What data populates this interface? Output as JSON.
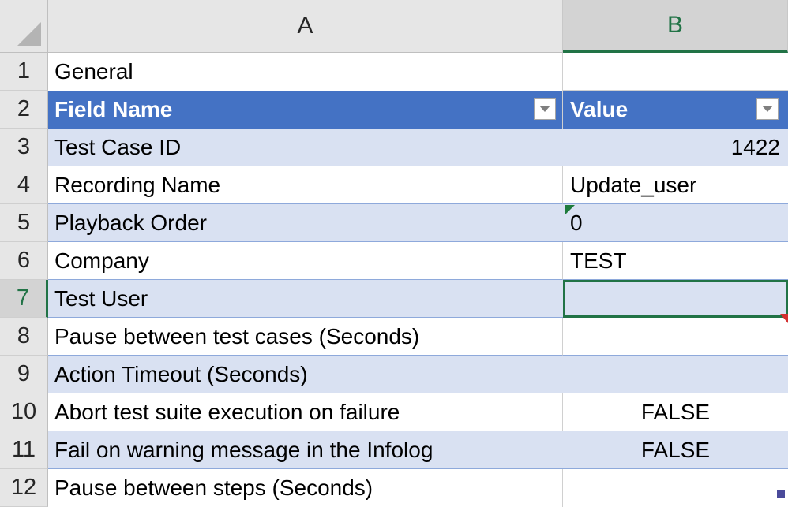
{
  "columns": {
    "a": "A",
    "b": "B"
  },
  "rows": [
    {
      "num": "1",
      "a": "General",
      "b": ""
    },
    {
      "num": "2",
      "a": "Field Name",
      "b": "Value"
    },
    {
      "num": "3",
      "a": "Test Case ID",
      "b": "1422"
    },
    {
      "num": "4",
      "a": "Recording Name",
      "b": "Update_user"
    },
    {
      "num": "5",
      "a": "Playback Order",
      "b": "0"
    },
    {
      "num": "6",
      "a": "Company",
      "b": "TEST"
    },
    {
      "num": "7",
      "a": "Test User",
      "b": ""
    },
    {
      "num": "8",
      "a": "Pause between test cases (Seconds)",
      "b": ""
    },
    {
      "num": "9",
      "a": "Action Timeout (Seconds)",
      "b": ""
    },
    {
      "num": "10",
      "a": "Abort test suite execution on failure",
      "b": "FALSE"
    },
    {
      "num": "11",
      "a": "Fail on warning message in the Infolog",
      "b": "FALSE"
    },
    {
      "num": "12",
      "a": "Pause between steps (Seconds)",
      "b": ""
    }
  ],
  "colors": {
    "header_fill": "#4472c4",
    "band_fill": "#d9e1f2",
    "selection": "#217346"
  },
  "icons": {
    "filter": "filter-dropdown-icon",
    "select_all": "select-all-icon"
  }
}
